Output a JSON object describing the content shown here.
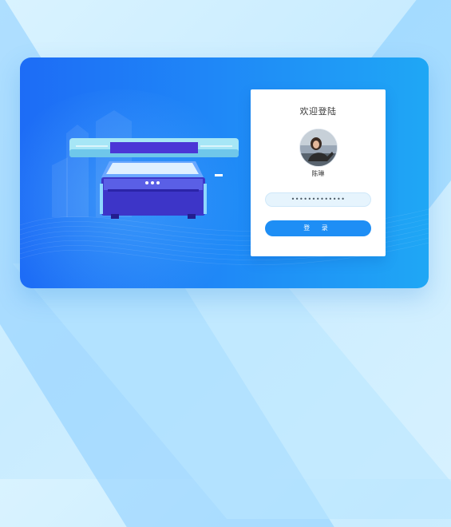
{
  "login": {
    "title": "欢迎登陆",
    "username": "陈琳",
    "password_value": "•••••••••••••",
    "login_button": "登 录"
  },
  "colors": {
    "card_gradient_start": "#1d6cf6",
    "card_gradient_end": "#1fa7f5",
    "button": "#1e8ef5",
    "input_bg": "#e6f4fd",
    "page_bg": "#d9f3ff"
  },
  "icons": {
    "avatar": "user-avatar",
    "illustration": "uv-printer-illustration"
  }
}
